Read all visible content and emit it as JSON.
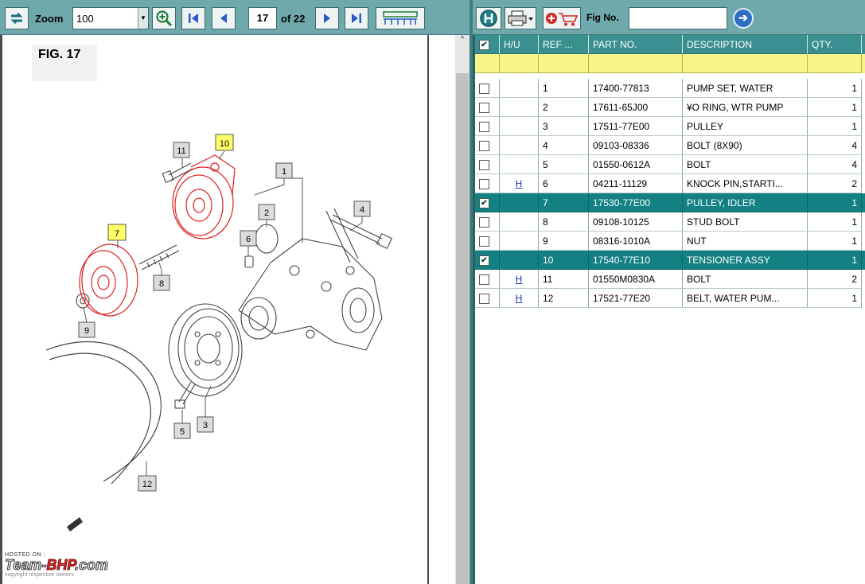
{
  "viewer_toolbar": {
    "zoom_label": "Zoom",
    "zoom_value": "100",
    "page_current": "17",
    "page_total_label": "of 22"
  },
  "diagram": {
    "figure_title": "FIG. 17",
    "callouts": [
      "1",
      "2",
      "3",
      "4",
      "5",
      "6",
      "7",
      "8",
      "9",
      "10",
      "11",
      "12"
    ],
    "highlighted_callouts": [
      "7",
      "10"
    ],
    "highlight_color": "#ffff66",
    "highlight_part_color": "#e02020"
  },
  "watermark": {
    "hosted": "HOSTED ON :",
    "brand_prefix": "Team-",
    "brand_main": "BHP",
    "brand_suffix": ".com",
    "copyright": "copyright respective owners"
  },
  "parts_toolbar": {
    "fig_no_label": "Fig No.",
    "fig_no_value": ""
  },
  "parts_table": {
    "columns": [
      "H/U",
      "REF ...",
      "PART NO.",
      "DESCRIPTION",
      "QTY."
    ],
    "header_checked": true,
    "rows": [
      {
        "checked": false,
        "hu": "",
        "ref": "1",
        "part_no": "17400-77813",
        "description": "PUMP SET, WATER",
        "qty": "1"
      },
      {
        "checked": false,
        "hu": "",
        "ref": "2",
        "part_no": "17611-65J00",
        "description": "¥O RING, WTR PUMP",
        "qty": "1"
      },
      {
        "checked": false,
        "hu": "",
        "ref": "3",
        "part_no": "17511-77E00",
        "description": "PULLEY",
        "qty": "1"
      },
      {
        "checked": false,
        "hu": "",
        "ref": "4",
        "part_no": "09103-08336",
        "description": "BOLT (8X90)",
        "qty": "4"
      },
      {
        "checked": false,
        "hu": "",
        "ref": "5",
        "part_no": "01550-0612A",
        "description": "BOLT",
        "qty": "4"
      },
      {
        "checked": false,
        "hu": "H",
        "ref": "6",
        "part_no": "04211-11129",
        "description": "KNOCK PIN,STARTI...",
        "qty": "2"
      },
      {
        "checked": true,
        "hu": "",
        "ref": "7",
        "part_no": "17530-77E00",
        "description": "PULLEY, IDLER",
        "qty": "1"
      },
      {
        "checked": false,
        "hu": "",
        "ref": "8",
        "part_no": "09108-10125",
        "description": "STUD BOLT",
        "qty": "1"
      },
      {
        "checked": false,
        "hu": "",
        "ref": "9",
        "part_no": "08316-1010A",
        "description": "NUT",
        "qty": "1"
      },
      {
        "checked": true,
        "hu": "",
        "ref": "10",
        "part_no": "17540-77E10",
        "description": "TENSIONER ASSY",
        "qty": "1"
      },
      {
        "checked": false,
        "hu": "H",
        "ref": "11",
        "part_no": "01550M0830A",
        "description": "BOLT",
        "qty": "2"
      },
      {
        "checked": false,
        "hu": "H",
        "ref": "12",
        "part_no": "17521-77E20",
        "description": "BELT, WATER PUM...",
        "qty": "1"
      }
    ]
  },
  "colors": {
    "toolbar": "#6fa9ab",
    "header": "#3a8f90",
    "selected_row": "#138183",
    "filter_row": "#f7f48a"
  }
}
